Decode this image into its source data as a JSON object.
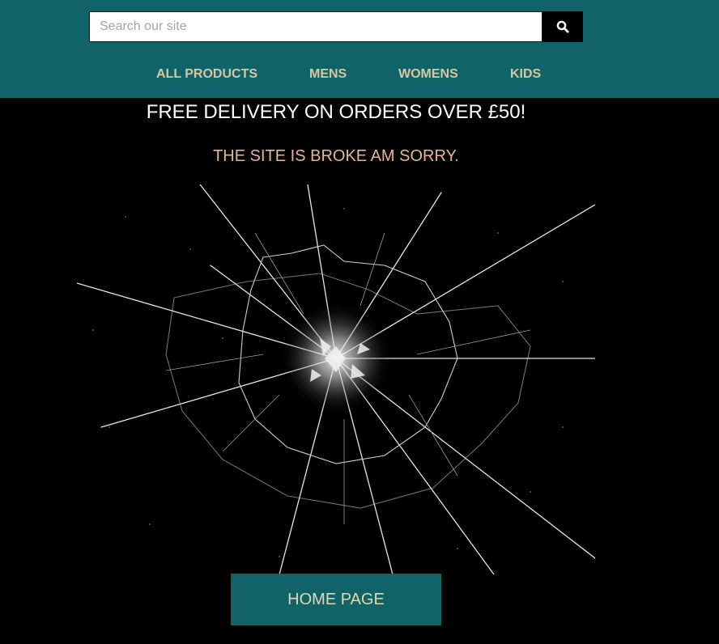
{
  "header": {
    "background_color": "#106467",
    "search": {
      "placeholder": "Search our site",
      "value": "",
      "button_icon": "search-icon"
    },
    "nav": {
      "items": [
        {
          "label": "ALL PRODUCTS"
        },
        {
          "label": "MENS"
        },
        {
          "label": "WOMENS"
        },
        {
          "label": "KIDS"
        }
      ],
      "text_color": "#d8c6a3"
    }
  },
  "main": {
    "promo_text": "FREE DELIVERY ON ORDERS OVER £50!",
    "error_text": "THE SITE IS BROKE AM SORRY.",
    "error_color": "#e8b592",
    "image_icon": "shattered-glass-icon",
    "home_button_label": "HOME PAGE"
  }
}
